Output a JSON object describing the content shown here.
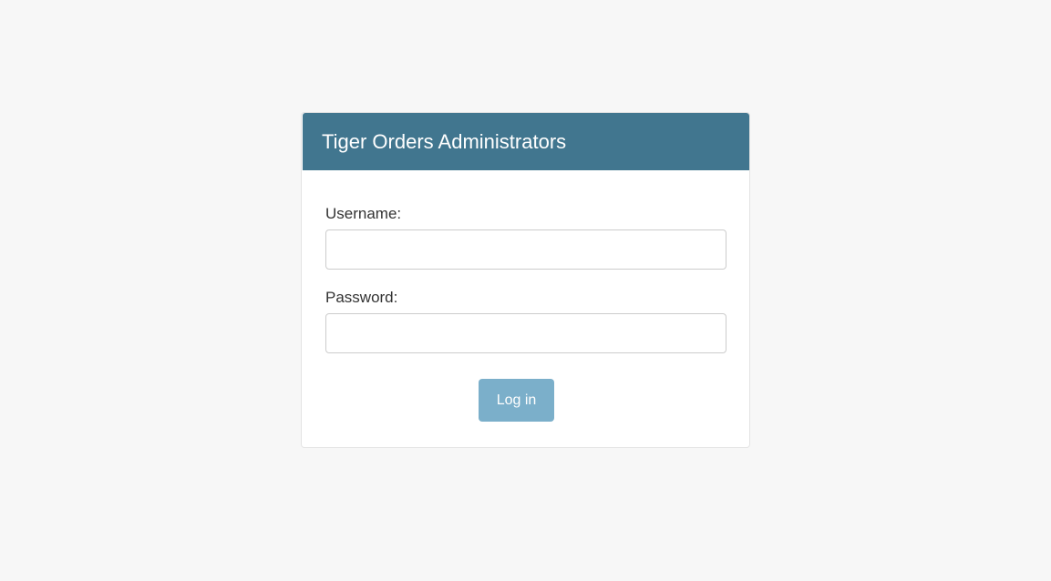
{
  "panel": {
    "title": "Tiger Orders Administrators",
    "header_color": "#41768f"
  },
  "form": {
    "username_label": "Username:",
    "username_value": "",
    "password_label": "Password:",
    "password_value": "",
    "submit_label": "Log in",
    "submit_color": "#7bafca"
  },
  "colors": {
    "page_background": "#f7f7f7",
    "panel_background": "#ffffff"
  }
}
